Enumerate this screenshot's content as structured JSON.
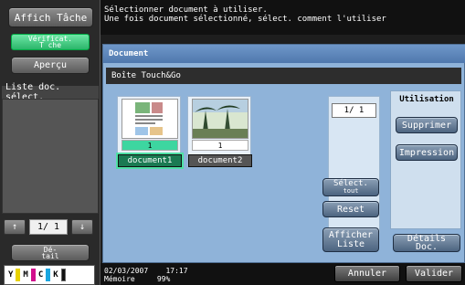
{
  "left": {
    "affich_tache": "Affich Tâche",
    "verificat_line1": "Vérificat.",
    "verificat_line2": "T che",
    "apercu": "Aperçu",
    "liste_doc": "Liste doc. sélect.",
    "pager_up": "↑",
    "pager_text": "1/  1",
    "pager_down": "↓",
    "detail_line1": "Dé-",
    "detail_line2": "tail"
  },
  "toner": {
    "labels": [
      "Y",
      "M",
      "C",
      "K"
    ],
    "colors": [
      "#e8d200",
      "#d10f8c",
      "#19a6e0",
      "#111111"
    ]
  },
  "message": {
    "line1": "Sélectionner document à utiliser.",
    "line2": "Une fois document sélectionné, sélect. comment l'utiliser"
  },
  "window": {
    "title": "Document",
    "box_name": "Boîte Touch&Go"
  },
  "documents": [
    {
      "name": "document1",
      "pages": "1",
      "selected": true
    },
    {
      "name": "document2",
      "pages": "1",
      "selected": false
    }
  ],
  "page_indicator": "1/  1",
  "actions": {
    "select_all_line1": "Sélect.",
    "select_all_line2": "tout",
    "reset": "Reset",
    "afficher_line1": "Afficher",
    "afficher_line2": "Liste"
  },
  "utilisation": {
    "title": "Utilisation",
    "supprimer": "Supprimer",
    "impression": "Impression",
    "details_doc": "Détails Doc."
  },
  "bottom": {
    "date": "02/03/2007",
    "time": "17:17",
    "memory_label": "Mémoire",
    "memory_value": "99%",
    "annuler": "Annuler",
    "valider": "Valider"
  }
}
